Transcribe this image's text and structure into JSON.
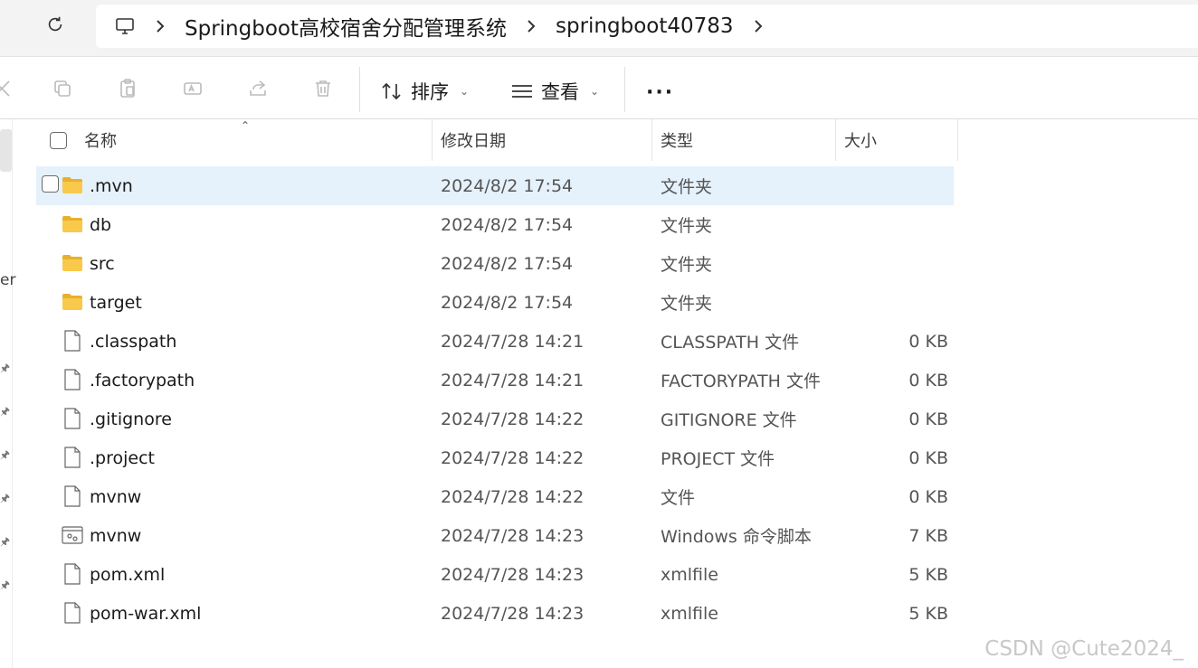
{
  "breadcrumb": {
    "items": [
      "Springboot高校宿舍分配管理系统",
      "springboot40783"
    ]
  },
  "toolbar": {
    "sort_label": "排序",
    "view_label": "查看",
    "more_label": "···"
  },
  "sidebar": {
    "fragment": "er"
  },
  "columns": {
    "name": "名称",
    "modified": "修改日期",
    "type": "类型",
    "size": "大小"
  },
  "files": [
    {
      "name": ".mvn",
      "modified": "2024/8/2 17:54",
      "type": "文件夹",
      "size": "",
      "icon": "folder-icon"
    },
    {
      "name": "db",
      "modified": "2024/8/2 17:54",
      "type": "文件夹",
      "size": "",
      "icon": "folder-icon"
    },
    {
      "name": "src",
      "modified": "2024/8/2 17:54",
      "type": "文件夹",
      "size": "",
      "icon": "folder-icon"
    },
    {
      "name": "target",
      "modified": "2024/8/2 17:54",
      "type": "文件夹",
      "size": "",
      "icon": "folder-icon"
    },
    {
      "name": ".classpath",
      "modified": "2024/7/28 14:21",
      "type": "CLASSPATH 文件",
      "size": "0 KB",
      "icon": "file-icon"
    },
    {
      "name": ".factorypath",
      "modified": "2024/7/28 14:21",
      "type": "FACTORYPATH 文件",
      "size": "0 KB",
      "icon": "file-icon"
    },
    {
      "name": ".gitignore",
      "modified": "2024/7/28 14:22",
      "type": "GITIGNORE 文件",
      "size": "0 KB",
      "icon": "file-icon"
    },
    {
      "name": ".project",
      "modified": "2024/7/28 14:22",
      "type": "PROJECT 文件",
      "size": "0 KB",
      "icon": "file-icon"
    },
    {
      "name": "mvnw",
      "modified": "2024/7/28 14:22",
      "type": "文件",
      "size": "0 KB",
      "icon": "file-icon"
    },
    {
      "name": "mvnw",
      "modified": "2024/7/28 14:23",
      "type": "Windows 命令脚本",
      "size": "7 KB",
      "icon": "script-icon"
    },
    {
      "name": "pom.xml",
      "modified": "2024/7/28 14:23",
      "type": "xmlfile",
      "size": "5 KB",
      "icon": "file-icon"
    },
    {
      "name": "pom-war.xml",
      "modified": "2024/7/28 14:23",
      "type": "xmlfile",
      "size": "5 KB",
      "icon": "file-icon"
    }
  ],
  "watermark": "CSDN @Cute2024_",
  "colors": {
    "selected_row": "#e5f1fb",
    "folder": "#f8c94a"
  }
}
